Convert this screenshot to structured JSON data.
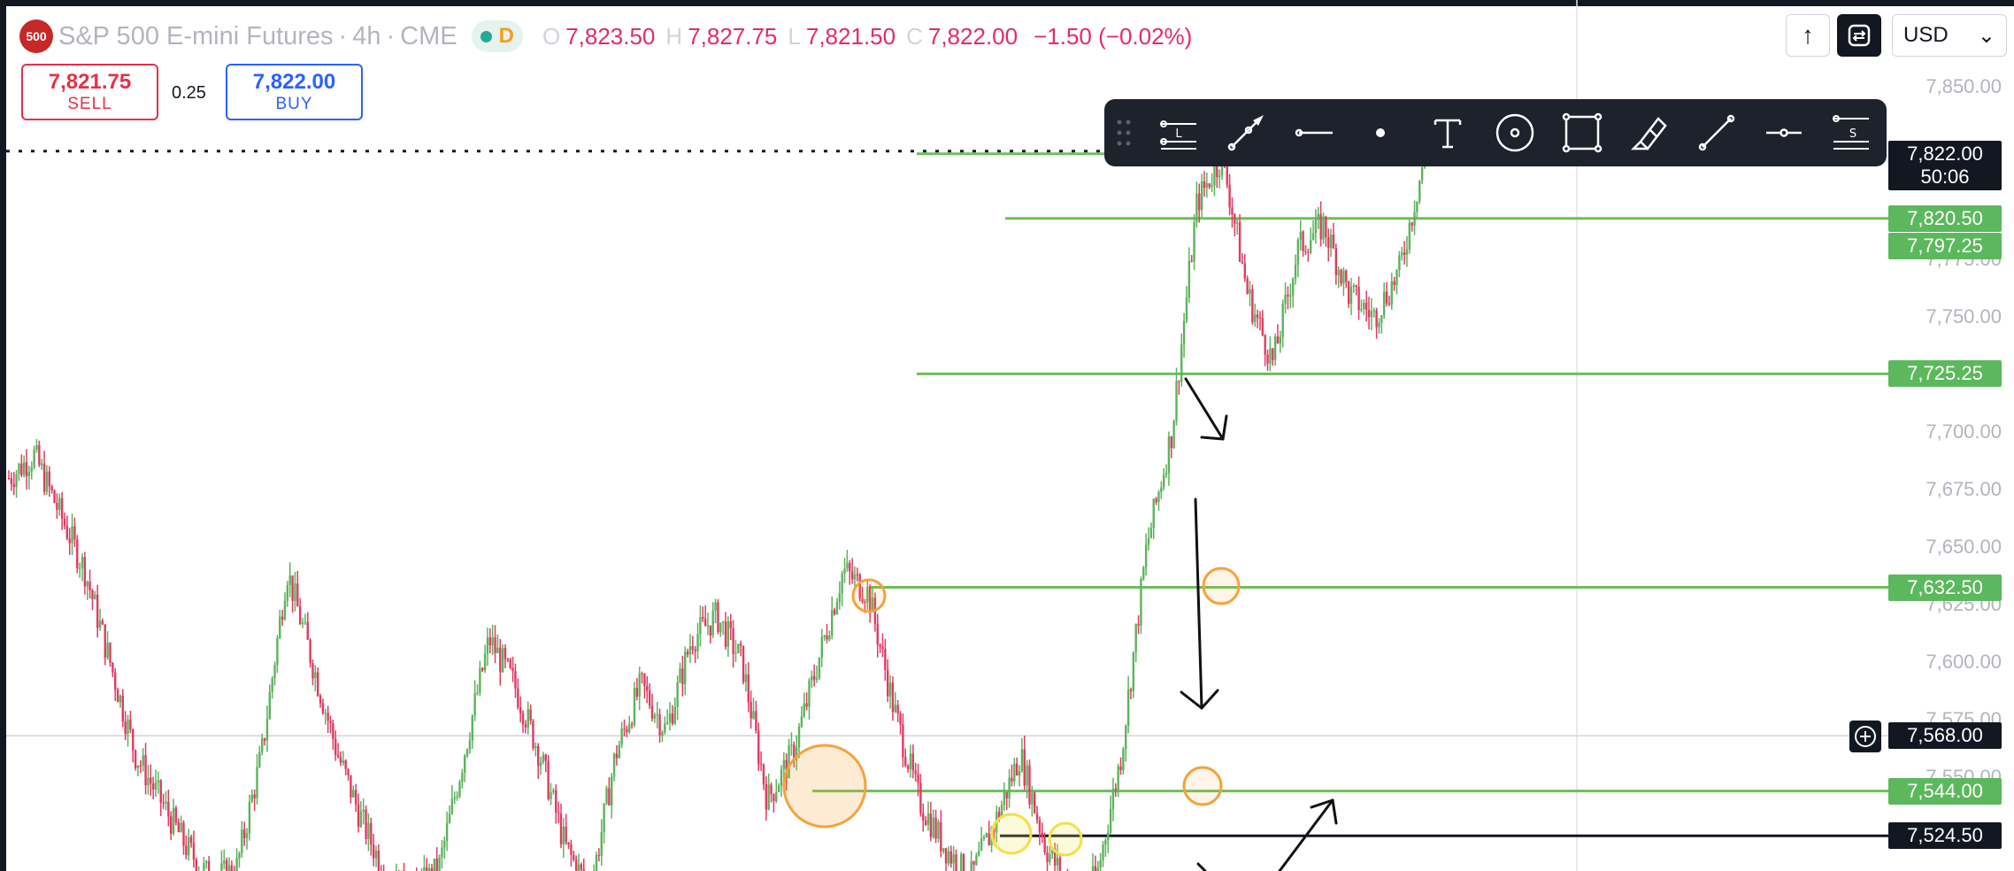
{
  "header": {
    "symbol_logo": "500",
    "symbol_name": "S&P 500 E-mini Futures",
    "interval": "4h",
    "exchange": "CME",
    "dot": "·",
    "status_letter": "D",
    "ohlc": [
      {
        "key": "O",
        "value": "7,823.50"
      },
      {
        "key": "H",
        "value": "7,827.75"
      },
      {
        "key": "L",
        "value": "7,821.50"
      },
      {
        "key": "C",
        "value": "7,822.00"
      }
    ],
    "change": "−1.50 (−0.02%)"
  },
  "trade": {
    "sell_price": "7,821.75",
    "sell_label": "SELL",
    "spread": "0.25",
    "buy_price": "7,822.00",
    "buy_label": "BUY"
  },
  "top_right": {
    "arrow_glyph": "↑",
    "currency": "USD",
    "chevron": "⌄"
  },
  "toolbar": {
    "tools": [
      "grip-icon",
      "horizontal-lines-label-icon",
      "pen-arrow-icon",
      "horizontal-ray-icon",
      "dot-icon",
      "text-tool-icon",
      "circle-tool-icon",
      "rectangle-tool-icon",
      "highlighter-icon",
      "trend-line-icon",
      "horizontal-segment-icon",
      "settings-lines-icon"
    ],
    "line_label_letter": "L",
    "settings_letter": "S"
  },
  "price_axis": {
    "ticks": [
      7850,
      7775,
      7750,
      7700,
      7675,
      7650,
      7600,
      7575,
      7550,
      7625
    ],
    "tick_labels": {
      "7850": "7,850.00",
      "7775": "7,775.00",
      "7750": "7,750.00",
      "7700": "7,700.00",
      "7675": "7,675.00",
      "7650": "7,650.00",
      "7625": "7,625.00",
      "7600": "7,600.00",
      "7575": "7,575.00",
      "7550": "7,550.00"
    },
    "labels": [
      {
        "price": 7822.0,
        "text": "7,822.00",
        "sub": "50:06",
        "style": "current"
      },
      {
        "price": 7820.5,
        "text": "7,820.50",
        "style": "green"
      },
      {
        "price": 7797.25,
        "text": "7,797.25",
        "style": "green"
      },
      {
        "price": 7725.25,
        "text": "7,725.25",
        "style": "green"
      },
      {
        "price": 7632.5,
        "text": "7,632.50",
        "style": "green"
      },
      {
        "price": 7568.0,
        "text": "7,568.00",
        "style": "crosshair"
      },
      {
        "price": 7544.0,
        "text": "7,544.00",
        "style": "green"
      },
      {
        "price": 7524.5,
        "text": "7,524.50",
        "style": "black"
      }
    ]
  },
  "colors": {
    "up": "#5cb35c",
    "down": "#e03a63",
    "level": "#6cbf5a",
    "orange": "#f5a23c",
    "yellow": "#f3e04a",
    "dark": "#131722"
  },
  "chart_data": {
    "type": "candlestick",
    "x_unit": "4h bars",
    "y_axis_range": [
      7495,
      7868
    ],
    "levels": [
      7822.0,
      7820.5,
      7725.25,
      7632.5,
      7544.0,
      7524.5
    ],
    "crosshair_price": 7568.0,
    "ohlc_waypoints_close": [
      7680,
      7690,
      7665,
      7640,
      7600,
      7560,
      7540,
      7520,
      7505,
      7510,
      7560,
      7640,
      7600,
      7560,
      7530,
      7505,
      7500,
      7510,
      7560,
      7610,
      7590,
      7560,
      7520,
      7500,
      7560,
      7590,
      7570,
      7610,
      7620,
      7600,
      7540,
      7560,
      7600,
      7640,
      7630,
      7580,
      7540,
      7520,
      7505,
      7530,
      7560,
      7520,
      7500,
      7505,
      7560,
      7650,
      7700,
      7800,
      7820,
      7760,
      7730,
      7780,
      7790,
      7760,
      7750,
      7770,
      7820
    ]
  }
}
